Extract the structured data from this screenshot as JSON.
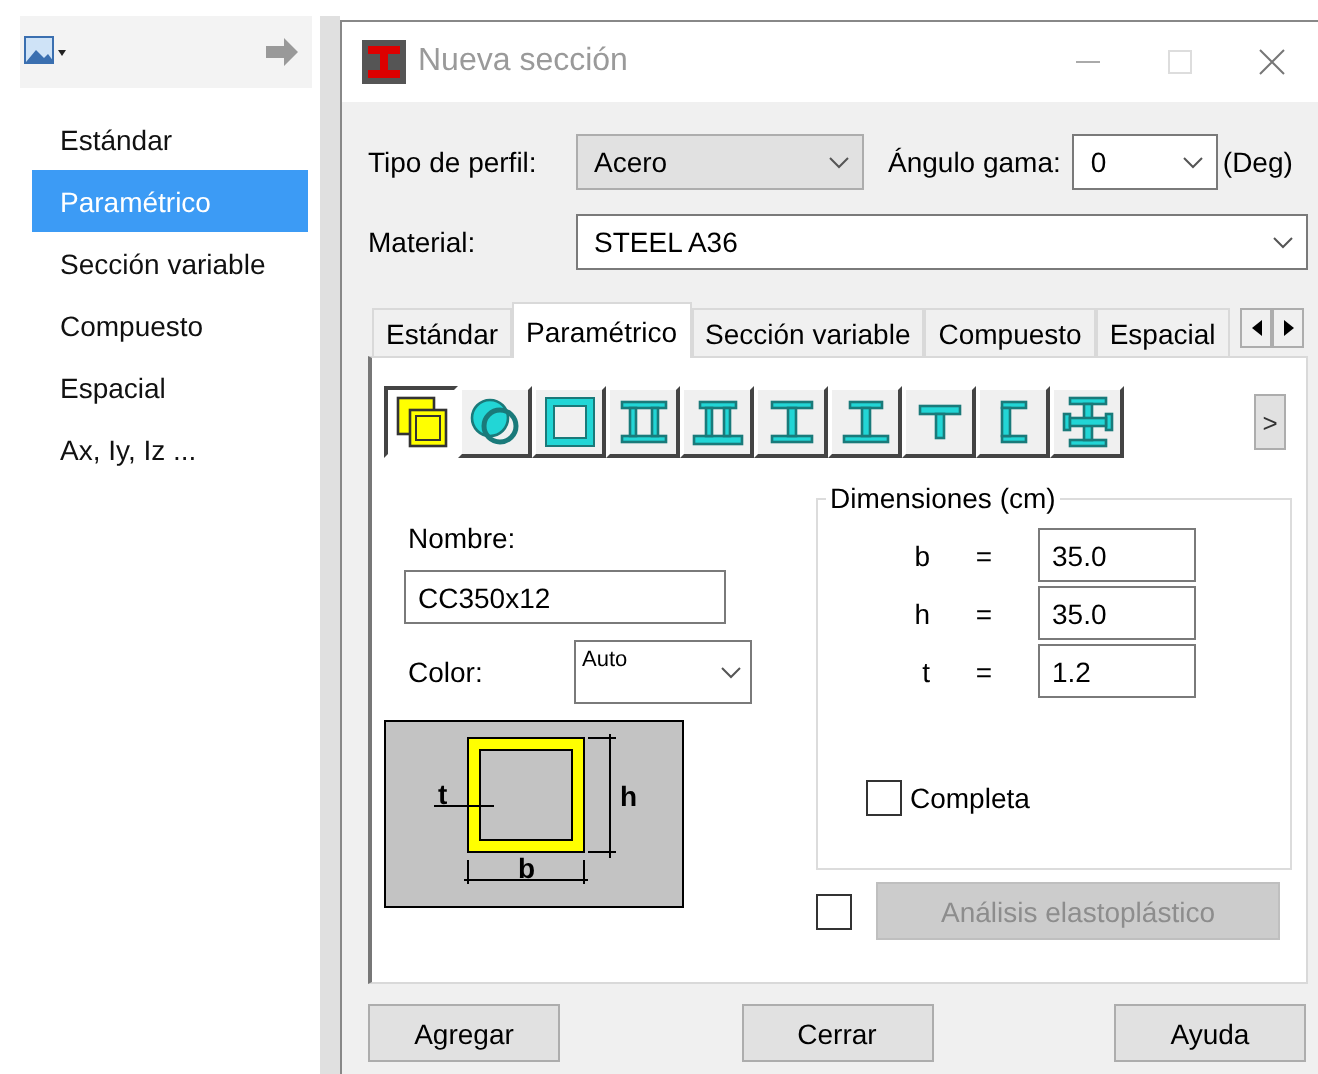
{
  "sidebar": {
    "items": [
      {
        "label": "Estándar",
        "selected": false
      },
      {
        "label": "Paramétrico",
        "selected": true
      },
      {
        "label": "Sección variable",
        "selected": false
      },
      {
        "label": "Compuesto",
        "selected": false
      },
      {
        "label": "Espacial",
        "selected": false
      },
      {
        "label": "Ax, Iy, Iz ...",
        "selected": false
      }
    ]
  },
  "window": {
    "title": "Nueva sección"
  },
  "profile_type": {
    "label": "Tipo de perfil:",
    "value": "Acero"
  },
  "gamma_angle": {
    "label": "Ángulo gama:",
    "value": "0",
    "unit": "(Deg)"
  },
  "material": {
    "label": "Material:",
    "value": "STEEL A36"
  },
  "tabs": [
    {
      "label": "Estándar",
      "selected": false
    },
    {
      "label": "Paramétrico",
      "selected": true
    },
    {
      "label": "Sección variable",
      "selected": false
    },
    {
      "label": "Compuesto",
      "selected": false
    },
    {
      "label": "Espacial",
      "selected": false
    }
  ],
  "section_types": [
    {
      "kind": "double-box",
      "selected": true
    },
    {
      "kind": "double-circle",
      "selected": false
    },
    {
      "kind": "box",
      "selected": false
    },
    {
      "kind": "double-web",
      "selected": false
    },
    {
      "kind": "double-web-wide",
      "selected": false
    },
    {
      "kind": "i-beam",
      "selected": false
    },
    {
      "kind": "i-beam-wide",
      "selected": false
    },
    {
      "kind": "tee",
      "selected": false
    },
    {
      "kind": "channel",
      "selected": false
    },
    {
      "kind": "cross",
      "selected": false
    }
  ],
  "more_button": ">",
  "name": {
    "label": "Nombre:",
    "value": "CC350x12"
  },
  "color": {
    "label": "Color:",
    "value": "Auto"
  },
  "diagram": {
    "t": "t",
    "h": "h",
    "b": "b"
  },
  "dimensions": {
    "title": "Dimensiones (cm)",
    "rows": [
      {
        "symbol": "b",
        "eq": "=",
        "value": "35.0"
      },
      {
        "symbol": "h",
        "eq": "=",
        "value": "35.0"
      },
      {
        "symbol": "t",
        "eq": "=",
        "value": "1.2"
      }
    ],
    "complete": {
      "label": "Completa",
      "checked": false
    }
  },
  "elastoplastic": {
    "checked": false,
    "label": "Análisis elastoplástico",
    "disabled": true
  },
  "buttons": [
    "Agregar",
    "Cerrar",
    "Ayuda"
  ]
}
